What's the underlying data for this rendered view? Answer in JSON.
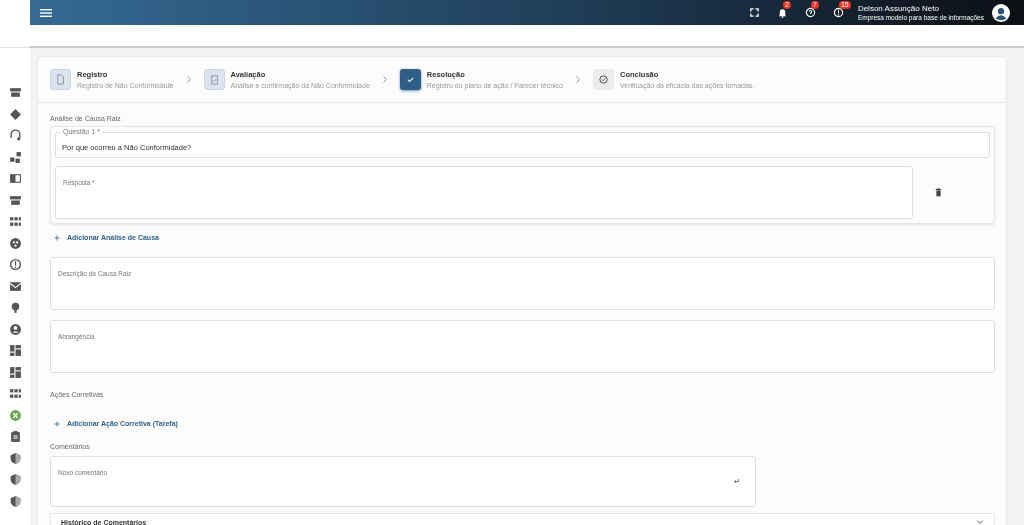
{
  "header": {
    "notifications": [
      {
        "kind": "bell",
        "badge": "2"
      },
      {
        "kind": "help",
        "badge": "7"
      },
      {
        "kind": "alert",
        "badge": "15"
      }
    ],
    "user": {
      "name": "Delson Assunção Neto",
      "company": "Empresa modelo para base de informações"
    }
  },
  "steps": [
    {
      "title": "Registro",
      "subtitle": "Registro de Não Conformidade",
      "completed": true,
      "selected": false
    },
    {
      "title": "Avaliação",
      "subtitle": "Análise e confirmação da Não Conformidade",
      "completed": true,
      "selected": false
    },
    {
      "title": "Resolução",
      "subtitle": "Registro do plano de ação / Parecer técnico",
      "completed": false,
      "selected": true
    },
    {
      "title": "Conclusão",
      "subtitle": "Verificação da eficácia das ações tomadas.",
      "completed": false,
      "selected": false
    }
  ],
  "root_cause": {
    "title": "Análise de Causa Raiz",
    "questions": [
      {
        "label": "Questão 1 *",
        "value": "Por que ocorreu a Não Conformidade?",
        "answer_placeholder": "Resposta *"
      }
    ],
    "add_link": "Adicionar Análise de Causa"
  },
  "description": {
    "placeholder": "Descrição da Causa Raiz"
  },
  "scope": {
    "placeholder": "Abrangência"
  },
  "corrective_actions": {
    "title": "Ações Corretivas",
    "add_link": "Adicionar Ação Corretiva (Tarefa)"
  },
  "comments": {
    "title": "Comentários",
    "placeholder": "Novo comentário",
    "history_title": "Histórico de Comentários",
    "history_expanded": false
  }
}
